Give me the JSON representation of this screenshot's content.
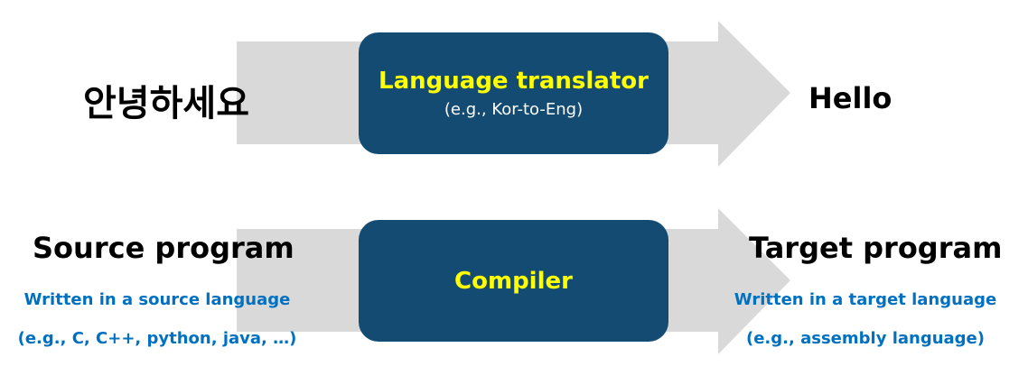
{
  "row1": {
    "input": "안녕하세요",
    "process_title": "Language translator",
    "process_subtitle": "(e.g., Kor-to-Eng)",
    "output": "Hello"
  },
  "row2": {
    "input": "Source program",
    "input_desc_1": "Written in a source language",
    "input_desc_2": "(e.g., C, C++, python, java, …)",
    "process_title": "Compiler",
    "output": "Target program",
    "output_desc_1": "Written in a target language",
    "output_desc_2": "(e.g., assembly language)"
  },
  "colors": {
    "arrow": "#d9d9d9",
    "box": "#134b72",
    "box_title": "#ffff00",
    "box_subtitle": "#ffffff",
    "blue_text": "#0070c0",
    "black_text": "#000000"
  }
}
